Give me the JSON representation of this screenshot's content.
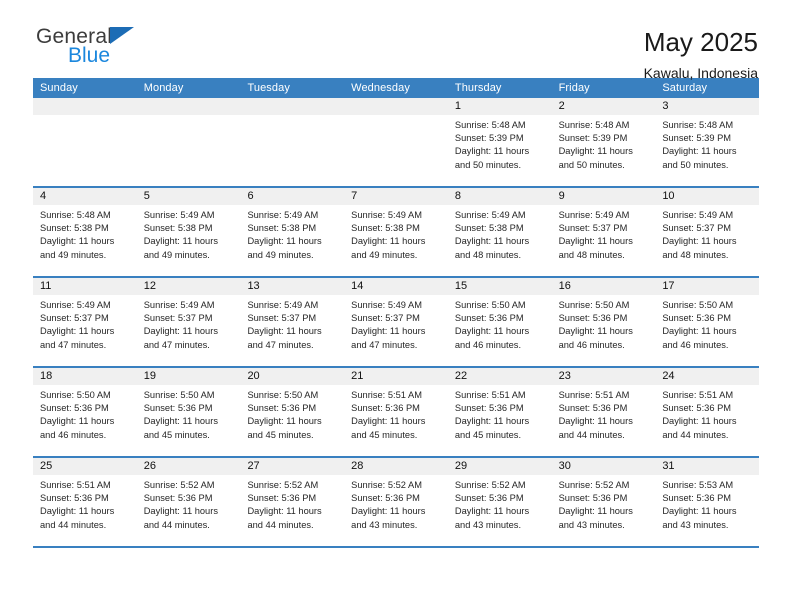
{
  "logo": {
    "part1": "General",
    "part2": "Blue",
    "triangle_color": "#1c6cb5",
    "blue_color": "#1b87dd"
  },
  "header": {
    "title": "May 2025",
    "subtitle": "Kawalu, Indonesia"
  },
  "theme": {
    "accent": "#3980c0",
    "daynum_band": "#f0f0f0",
    "text": "#262626"
  },
  "weekdays": [
    "Sunday",
    "Monday",
    "Tuesday",
    "Wednesday",
    "Thursday",
    "Friday",
    "Saturday"
  ],
  "weeks": [
    {
      "days": [
        {
          "num": "",
          "empty": true,
          "l1": "",
          "l2": "",
          "l3": "",
          "l4": ""
        },
        {
          "num": "",
          "empty": true,
          "l1": "",
          "l2": "",
          "l3": "",
          "l4": ""
        },
        {
          "num": "",
          "empty": true,
          "l1": "",
          "l2": "",
          "l3": "",
          "l4": ""
        },
        {
          "num": "",
          "empty": true,
          "l1": "",
          "l2": "",
          "l3": "",
          "l4": ""
        },
        {
          "num": "1",
          "l1": "Sunrise: 5:48 AM",
          "l2": "Sunset: 5:39 PM",
          "l3": "Daylight: 11 hours",
          "l4": "and 50 minutes."
        },
        {
          "num": "2",
          "l1": "Sunrise: 5:48 AM",
          "l2": "Sunset: 5:39 PM",
          "l3": "Daylight: 11 hours",
          "l4": "and 50 minutes."
        },
        {
          "num": "3",
          "l1": "Sunrise: 5:48 AM",
          "l2": "Sunset: 5:39 PM",
          "l3": "Daylight: 11 hours",
          "l4": "and 50 minutes."
        }
      ]
    },
    {
      "days": [
        {
          "num": "4",
          "l1": "Sunrise: 5:48 AM",
          "l2": "Sunset: 5:38 PM",
          "l3": "Daylight: 11 hours",
          "l4": "and 49 minutes."
        },
        {
          "num": "5",
          "l1": "Sunrise: 5:49 AM",
          "l2": "Sunset: 5:38 PM",
          "l3": "Daylight: 11 hours",
          "l4": "and 49 minutes."
        },
        {
          "num": "6",
          "l1": "Sunrise: 5:49 AM",
          "l2": "Sunset: 5:38 PM",
          "l3": "Daylight: 11 hours",
          "l4": "and 49 minutes."
        },
        {
          "num": "7",
          "l1": "Sunrise: 5:49 AM",
          "l2": "Sunset: 5:38 PM",
          "l3": "Daylight: 11 hours",
          "l4": "and 49 minutes."
        },
        {
          "num": "8",
          "l1": "Sunrise: 5:49 AM",
          "l2": "Sunset: 5:38 PM",
          "l3": "Daylight: 11 hours",
          "l4": "and 48 minutes."
        },
        {
          "num": "9",
          "l1": "Sunrise: 5:49 AM",
          "l2": "Sunset: 5:37 PM",
          "l3": "Daylight: 11 hours",
          "l4": "and 48 minutes."
        },
        {
          "num": "10",
          "l1": "Sunrise: 5:49 AM",
          "l2": "Sunset: 5:37 PM",
          "l3": "Daylight: 11 hours",
          "l4": "and 48 minutes."
        }
      ]
    },
    {
      "days": [
        {
          "num": "11",
          "l1": "Sunrise: 5:49 AM",
          "l2": "Sunset: 5:37 PM",
          "l3": "Daylight: 11 hours",
          "l4": "and 47 minutes."
        },
        {
          "num": "12",
          "l1": "Sunrise: 5:49 AM",
          "l2": "Sunset: 5:37 PM",
          "l3": "Daylight: 11 hours",
          "l4": "and 47 minutes."
        },
        {
          "num": "13",
          "l1": "Sunrise: 5:49 AM",
          "l2": "Sunset: 5:37 PM",
          "l3": "Daylight: 11 hours",
          "l4": "and 47 minutes."
        },
        {
          "num": "14",
          "l1": "Sunrise: 5:49 AM",
          "l2": "Sunset: 5:37 PM",
          "l3": "Daylight: 11 hours",
          "l4": "and 47 minutes."
        },
        {
          "num": "15",
          "l1": "Sunrise: 5:50 AM",
          "l2": "Sunset: 5:36 PM",
          "l3": "Daylight: 11 hours",
          "l4": "and 46 minutes."
        },
        {
          "num": "16",
          "l1": "Sunrise: 5:50 AM",
          "l2": "Sunset: 5:36 PM",
          "l3": "Daylight: 11 hours",
          "l4": "and 46 minutes."
        },
        {
          "num": "17",
          "l1": "Sunrise: 5:50 AM",
          "l2": "Sunset: 5:36 PM",
          "l3": "Daylight: 11 hours",
          "l4": "and 46 minutes."
        }
      ]
    },
    {
      "days": [
        {
          "num": "18",
          "l1": "Sunrise: 5:50 AM",
          "l2": "Sunset: 5:36 PM",
          "l3": "Daylight: 11 hours",
          "l4": "and 46 minutes."
        },
        {
          "num": "19",
          "l1": "Sunrise: 5:50 AM",
          "l2": "Sunset: 5:36 PM",
          "l3": "Daylight: 11 hours",
          "l4": "and 45 minutes."
        },
        {
          "num": "20",
          "l1": "Sunrise: 5:50 AM",
          "l2": "Sunset: 5:36 PM",
          "l3": "Daylight: 11 hours",
          "l4": "and 45 minutes."
        },
        {
          "num": "21",
          "l1": "Sunrise: 5:51 AM",
          "l2": "Sunset: 5:36 PM",
          "l3": "Daylight: 11 hours",
          "l4": "and 45 minutes."
        },
        {
          "num": "22",
          "l1": "Sunrise: 5:51 AM",
          "l2": "Sunset: 5:36 PM",
          "l3": "Daylight: 11 hours",
          "l4": "and 45 minutes."
        },
        {
          "num": "23",
          "l1": "Sunrise: 5:51 AM",
          "l2": "Sunset: 5:36 PM",
          "l3": "Daylight: 11 hours",
          "l4": "and 44 minutes."
        },
        {
          "num": "24",
          "l1": "Sunrise: 5:51 AM",
          "l2": "Sunset: 5:36 PM",
          "l3": "Daylight: 11 hours",
          "l4": "and 44 minutes."
        }
      ]
    },
    {
      "days": [
        {
          "num": "25",
          "l1": "Sunrise: 5:51 AM",
          "l2": "Sunset: 5:36 PM",
          "l3": "Daylight: 11 hours",
          "l4": "and 44 minutes."
        },
        {
          "num": "26",
          "l1": "Sunrise: 5:52 AM",
          "l2": "Sunset: 5:36 PM",
          "l3": "Daylight: 11 hours",
          "l4": "and 44 minutes."
        },
        {
          "num": "27",
          "l1": "Sunrise: 5:52 AM",
          "l2": "Sunset: 5:36 PM",
          "l3": "Daylight: 11 hours",
          "l4": "and 44 minutes."
        },
        {
          "num": "28",
          "l1": "Sunrise: 5:52 AM",
          "l2": "Sunset: 5:36 PM",
          "l3": "Daylight: 11 hours",
          "l4": "and 43 minutes."
        },
        {
          "num": "29",
          "l1": "Sunrise: 5:52 AM",
          "l2": "Sunset: 5:36 PM",
          "l3": "Daylight: 11 hours",
          "l4": "and 43 minutes."
        },
        {
          "num": "30",
          "l1": "Sunrise: 5:52 AM",
          "l2": "Sunset: 5:36 PM",
          "l3": "Daylight: 11 hours",
          "l4": "and 43 minutes."
        },
        {
          "num": "31",
          "l1": "Sunrise: 5:53 AM",
          "l2": "Sunset: 5:36 PM",
          "l3": "Daylight: 11 hours",
          "l4": "and 43 minutes."
        }
      ]
    }
  ]
}
